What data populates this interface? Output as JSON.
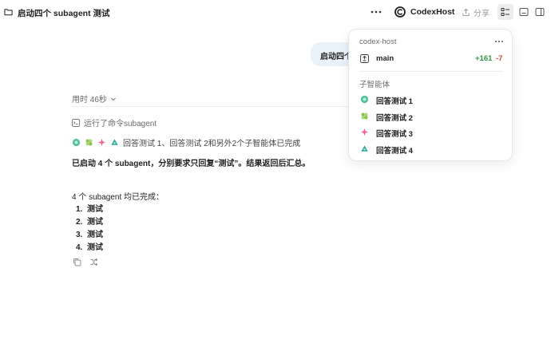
{
  "header": {
    "title": "启动四个 subagent 测试",
    "brand": "CodexHost",
    "share_label": "分享",
    "icons": [
      "folder-icon",
      "more-icon",
      "codex-logo-icon",
      "share-icon",
      "tasks-panel-icon",
      "terminal-panel-icon",
      "sidebar-panel-icon"
    ]
  },
  "conversation": {
    "user_message": "启动四个 subagent 测试",
    "elapsed_label": "用时 46秒",
    "ran_command": "运行了命令subagent",
    "agents_summary": "回答测试 1、回答测试 2和另外2个子智能体已完成",
    "assistant_summary": "已启动 4 个 subagent，分别要求只回复“测试”。结果返回后汇总。",
    "done_title": "4 个 subagent 均已完成：",
    "results": [
      {
        "num": "1.",
        "text": "测试"
      },
      {
        "num": "2.",
        "text": "测试"
      },
      {
        "num": "3.",
        "text": "测试"
      },
      {
        "num": "4.",
        "text": "测试"
      }
    ]
  },
  "popover": {
    "host": "codex-host",
    "branch": {
      "name": "main",
      "additions": "+161",
      "deletions": "-7"
    },
    "section_title": "子智能体",
    "agents": [
      {
        "name": "回答测试 1",
        "color": "#4fbf9a"
      },
      {
        "name": "回答测试 2",
        "color": "#8bc34a"
      },
      {
        "name": "回答测试 3",
        "color": "#f06292"
      },
      {
        "name": "回答测试 4",
        "color": "#26a69a"
      }
    ]
  },
  "colors": {
    "accent_bubble": "#e9f1fb",
    "additions": "#2e9a46",
    "deletions": "#d64545"
  }
}
